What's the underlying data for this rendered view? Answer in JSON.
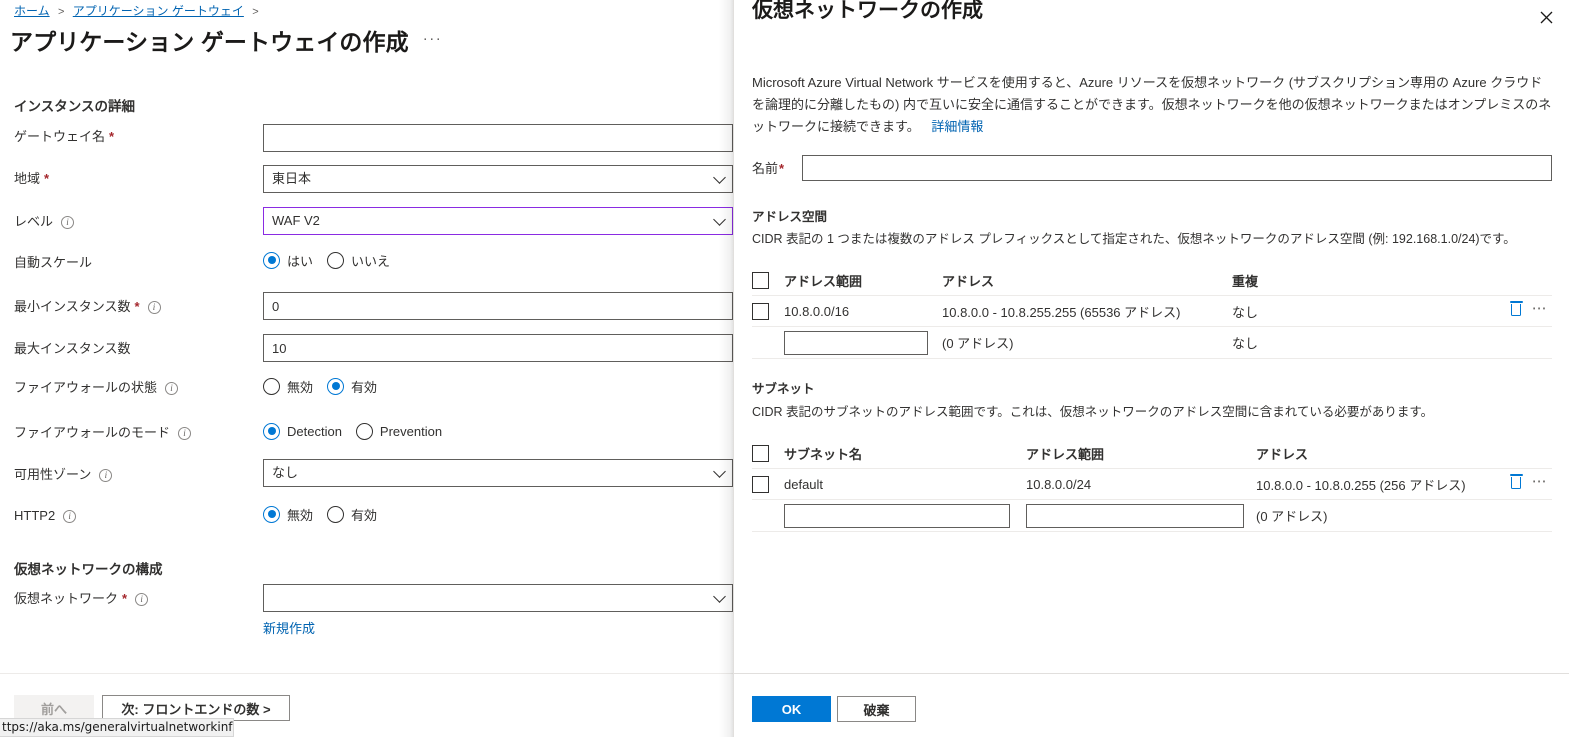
{
  "left": {
    "breadcrumb": [
      "ホーム",
      "アプリケーション ゲートウェイ"
    ],
    "page_title": "アプリケーション ゲートウェイの作成",
    "title_menu": "···",
    "section_instance": "インスタンスの詳細",
    "section_vnet": "仮想ネットワークの構成",
    "fields": {
      "gateway_name": {
        "label": "ゲートウェイ名",
        "value": ""
      },
      "region": {
        "label": "地域",
        "value": "東日本"
      },
      "tier": {
        "label": "レベル",
        "value": "WAF V2"
      },
      "autoscale": {
        "label": "自動スケール",
        "yes": "はい",
        "no": "いいえ",
        "selected": "はい"
      },
      "min_instances": {
        "label": "最小インスタンス数",
        "value": "0"
      },
      "max_instances": {
        "label": "最大インスタンス数",
        "value": "10"
      },
      "firewall_status": {
        "label": "ファイアウォールの状態",
        "off": "無効",
        "on": "有効",
        "selected": "有効"
      },
      "firewall_mode": {
        "label": "ファイアウォールのモード",
        "detection": "Detection",
        "prevention": "Prevention",
        "selected": "Detection"
      },
      "availability_zone": {
        "label": "可用性ゾーン",
        "value": "なし"
      },
      "http2": {
        "label": "HTTP2",
        "off": "無効",
        "on": "有効",
        "selected": "無効"
      },
      "virtual_network": {
        "label": "仮想ネットワーク",
        "value": "",
        "create_new": "新規作成"
      }
    },
    "footer": {
      "prev": "前へ",
      "next": "次: フロントエンドの数 >"
    },
    "statusbar_url": "ttps://aka.ms/generalvirtualnetworkinfo/"
  },
  "panel": {
    "title": "仮想ネットワークの作成",
    "close_icon": "close-icon",
    "description": "Microsoft Azure Virtual Network サービスを使用すると、Azure リソースを仮想ネットワーク (サブスクリプション専用の Azure クラウドを論理的に分離したもの) 内で互いに安全に通信することができます。仮想ネットワークを他の仮想ネットワークまたはオンプレミスのネットワークに接続できます。",
    "description_link": "詳細情報",
    "name_field": {
      "label": "名前",
      "value": "",
      "required": true
    },
    "address_space": {
      "heading": "アドレス空間",
      "help": "CIDR 表記の 1 つまたは複数のアドレス プレフィックスとして指定された、仮想ネットワークのアドレス空間 (例: 192.168.1.0/24)です。",
      "columns": [
        "アドレス範囲",
        "アドレス",
        "重複"
      ],
      "rows": [
        {
          "range": "10.8.0.0/16",
          "address": "10.8.0.0 - 10.8.255.255 (65536 アドレス)",
          "overlap": "なし",
          "checked": false
        }
      ],
      "new_row": {
        "range_value": "",
        "address": "(0 アドレス)",
        "overlap": "なし"
      }
    },
    "subnets": {
      "heading": "サブネット",
      "help": "CIDR 表記のサブネットのアドレス範囲です。これは、仮想ネットワークのアドレス空間に含まれている必要があります。",
      "columns": [
        "サブネット名",
        "アドレス範囲",
        "アドレス"
      ],
      "rows": [
        {
          "name": "default",
          "range": "10.8.0.0/24",
          "address": "10.8.0.0 - 10.8.0.255 (256 アドレス)",
          "checked": false
        }
      ],
      "new_row": {
        "name_value": "",
        "range_value": "",
        "address": "(0 アドレス)"
      }
    },
    "footer": {
      "ok": "OK",
      "cancel": "破棄"
    }
  },
  "colors": {
    "accent": "#0078d4",
    "link": "#0063b1",
    "required": "#a4262c",
    "focus_border": "#8a2be2",
    "text": "#323130"
  }
}
